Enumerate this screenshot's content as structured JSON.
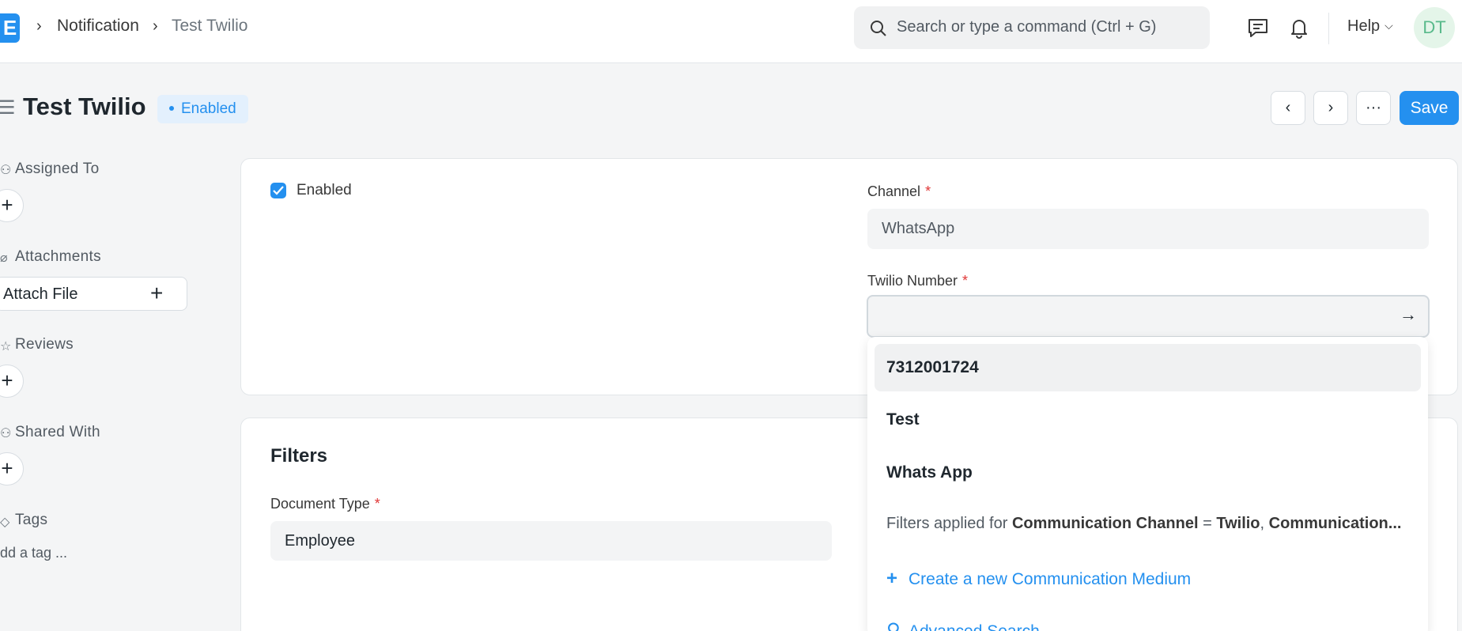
{
  "navbar": {
    "logo_letter": "E",
    "breadcrumbs": [
      "Notification",
      "Test Twilio"
    ],
    "search_placeholder": "Search or type a command (Ctrl + G)",
    "help_label": "Help",
    "avatar_initials": "DT"
  },
  "page": {
    "title": "Test Twilio",
    "status": "Enabled",
    "save_label": "Save",
    "more_label": "···",
    "prev_label": "‹",
    "next_label": "›"
  },
  "sidebar": {
    "assigned_to": "Assigned To",
    "attachments": "Attachments",
    "attach_file": "Attach File",
    "reviews": "Reviews",
    "shared_with": "Shared With",
    "tags": "Tags",
    "add_tag": "dd a tag ..."
  },
  "form": {
    "enabled_label": "Enabled",
    "enabled_checked": true,
    "channel_label": "Channel",
    "channel_value": "WhatsApp",
    "twilio_label": "Twilio Number",
    "twilio_value": "",
    "filters_title": "Filters",
    "doctype_label": "Document Type",
    "doctype_value": "Employee"
  },
  "dropdown": {
    "items": [
      "7312001724",
      "Test",
      "Whats App"
    ],
    "filter_prefix": "Filters applied for ",
    "filter_field_1": "Communication Channel",
    "filter_eq": " = ",
    "filter_value_1": "Twilio",
    "filter_sep": ", ",
    "filter_field_2": "Communication...",
    "create_new": "Create a new Communication Medium",
    "advanced_search": "Advanced Search"
  },
  "colors": {
    "primary": "#2490ef",
    "required": "#e03636",
    "badge_bg": "#e3f0fd",
    "avatar_bg": "#e4f5e9"
  }
}
